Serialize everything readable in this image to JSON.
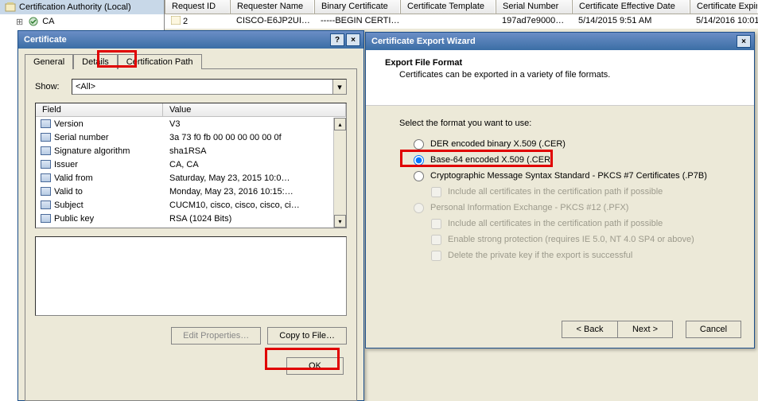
{
  "tree": {
    "root": "Certification Authority (Local)",
    "child": "CA"
  },
  "columns": [
    "Request ID",
    "Requester Name",
    "Binary Certificate",
    "Certificate Template",
    "Serial Number",
    "Certificate Effective Date",
    "Certificate Expira"
  ],
  "row": {
    "request_id": "2",
    "requester": "CISCO-E6JP2UI…",
    "binary": "-----BEGIN CERTI…",
    "template": "",
    "serial": "197ad7e9000…",
    "effective": "5/14/2015 9:51 AM",
    "expiry": "5/14/2016 10:01"
  },
  "cert_dialog": {
    "title": "Certificate",
    "tabs": {
      "general": "General",
      "details": "Details",
      "path": "Certification Path"
    },
    "show_label": "Show:",
    "show_value": "<All>",
    "headers": {
      "field": "Field",
      "value": "Value"
    },
    "fields": [
      {
        "f": "Version",
        "v": "V3"
      },
      {
        "f": "Serial number",
        "v": "3a 73 f0 fb 00 00 00 00 00 0f"
      },
      {
        "f": "Signature algorithm",
        "v": "sha1RSA"
      },
      {
        "f": "Issuer",
        "v": "CA, CA"
      },
      {
        "f": "Valid from",
        "v": "Saturday, May 23, 2015 10:0…"
      },
      {
        "f": "Valid to",
        "v": "Monday, May 23, 2016 10:15:…"
      },
      {
        "f": "Subject",
        "v": "CUCM10, cisco, cisco, cisco, ci…"
      },
      {
        "f": "Public key",
        "v": "RSA (1024 Bits)"
      }
    ],
    "edit_btn": "Edit Properties…",
    "copy_btn": "Copy to File…",
    "ok_btn": "OK"
  },
  "wizard": {
    "title": "Certificate Export Wizard",
    "heading": "Export File Format",
    "sub": "Certificates can be exported in a variety of file formats.",
    "select_label": "Select the format you want to use:",
    "opts": {
      "der": "DER encoded binary X.509 (.CER)",
      "b64": "Base-64 encoded X.509 (.CER)",
      "p7b": "Cryptographic Message Syntax Standard - PKCS #7 Certificates (.P7B)",
      "p7b_inc": "Include all certificates in the certification path if possible",
      "pfx": "Personal Information Exchange - PKCS #12 (.PFX)",
      "pfx_inc": "Include all certificates in the certification path if possible",
      "pfx_strong": "Enable strong protection (requires IE 5.0, NT 4.0 SP4 or above)",
      "pfx_del": "Delete the private key if the export is successful"
    },
    "back": "< Back",
    "next": "Next >",
    "cancel": "Cancel"
  }
}
